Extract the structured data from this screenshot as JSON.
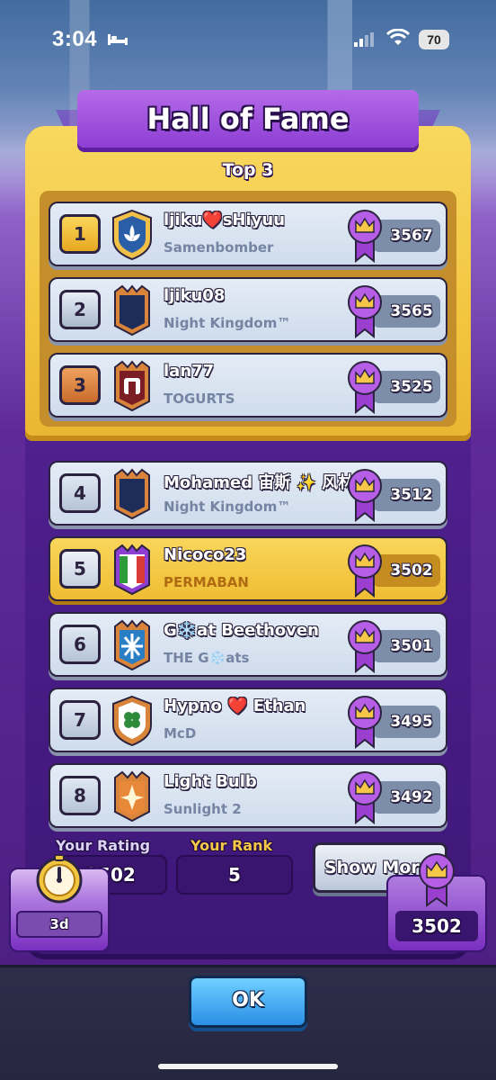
{
  "status_bar": {
    "time": "3:04",
    "battery": "70"
  },
  "header": {
    "title": "Hall of Fame",
    "subtitle": "Top 3"
  },
  "leaderboard": [
    {
      "rank": "1",
      "name": "ljiku❤️sHiyuu",
      "clan": "Samenbomber",
      "score": "3567",
      "badge_color": "#2a5fa8"
    },
    {
      "rank": "2",
      "name": "ljiku08",
      "clan": "Night Kingdom™",
      "score": "3565",
      "badge_color": "#1e2c5a"
    },
    {
      "rank": "3",
      "name": "lan77",
      "clan": "TOGURTS",
      "score": "3525",
      "badge_color": "#7a1e24"
    },
    {
      "rank": "4",
      "name": "Mohamed 宙斯 ✨ 风林",
      "clan": "Night Kingdom™",
      "score": "3512",
      "badge_color": "#1e2c5a"
    },
    {
      "rank": "5",
      "name": "Nicoco23",
      "clan": "PERMABAN",
      "score": "3502",
      "badge_color": "#2e7d32"
    },
    {
      "rank": "6",
      "name": "G❄️at Beethoven",
      "clan": "THE G❄️ats",
      "score": "3501",
      "badge_color": "#2a7fc4"
    },
    {
      "rank": "7",
      "name": "Hypno ❤️ Ethan",
      "clan": "McD",
      "score": "3495",
      "badge_color": "#2e8b3a"
    },
    {
      "rank": "8",
      "name": "Light Bulb",
      "clan": "Sunlight 2",
      "score": "3492",
      "badge_color": "#d3742a"
    }
  ],
  "stats": {
    "rating_label": "Your Rating",
    "rating_value": "3502",
    "rank_label": "Your Rank",
    "rank_value": "5",
    "show_more_label": "Show More"
  },
  "widgets": {
    "timer_value": "3d",
    "rating_value": "3502"
  },
  "footer": {
    "ok_label": "OK"
  },
  "colors": {
    "accent_purple": "#7a2fc0",
    "gold": "#f2c540",
    "ok_blue": "#2b8fe6"
  }
}
